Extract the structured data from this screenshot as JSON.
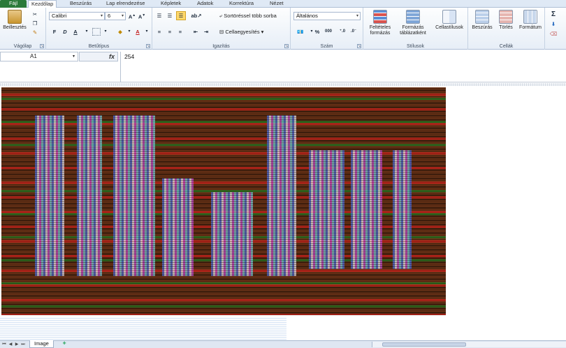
{
  "tabs": [
    {
      "label": "Fájl"
    },
    {
      "label": "Kezdőlap"
    },
    {
      "label": "Beszúrás"
    },
    {
      "label": "Lap elrendezése"
    },
    {
      "label": "Képletek"
    },
    {
      "label": "Adatok"
    },
    {
      "label": "Korrektúra"
    },
    {
      "label": "Nézet"
    }
  ],
  "ribbon": {
    "clipboard": {
      "paste_label": "Beillesztés",
      "group_label": "Vágólap"
    },
    "font": {
      "font_name": "Calibri",
      "font_size": "6",
      "group_label": "Betűtípus",
      "bold": "F",
      "italic": "D",
      "underline": "A"
    },
    "alignment": {
      "wrap_text": "Sortöréssel több sorba",
      "merge": "Cellaegyesítés",
      "group_label": "Igazítás"
    },
    "number": {
      "format": "Általános",
      "percent": "%",
      "thousands": "000",
      "group_label": "Szám"
    },
    "styles": {
      "conditional": "Feltételes formázás",
      "table": "Formázás táblázatként",
      "cell_styles": "Cellastílusok",
      "group_label": "Stílusok"
    },
    "cells": {
      "insert": "Beszúrás",
      "delete": "Törlés",
      "format": "Formátum",
      "group_label": "Cellák"
    },
    "editing": {
      "sum": "Σ"
    }
  },
  "formula_bar": {
    "name_box": "A1",
    "fx": "fx",
    "value": "254"
  },
  "sheet_tabs": [
    {
      "label": "Image"
    }
  ],
  "colors": {
    "accent": "#2a7a3a",
    "ribbon_border": "#aebfd6",
    "pixel_dark": "#5a2a14",
    "pixel_red": "#c0261c",
    "pixel_green": "#2f6d20"
  }
}
